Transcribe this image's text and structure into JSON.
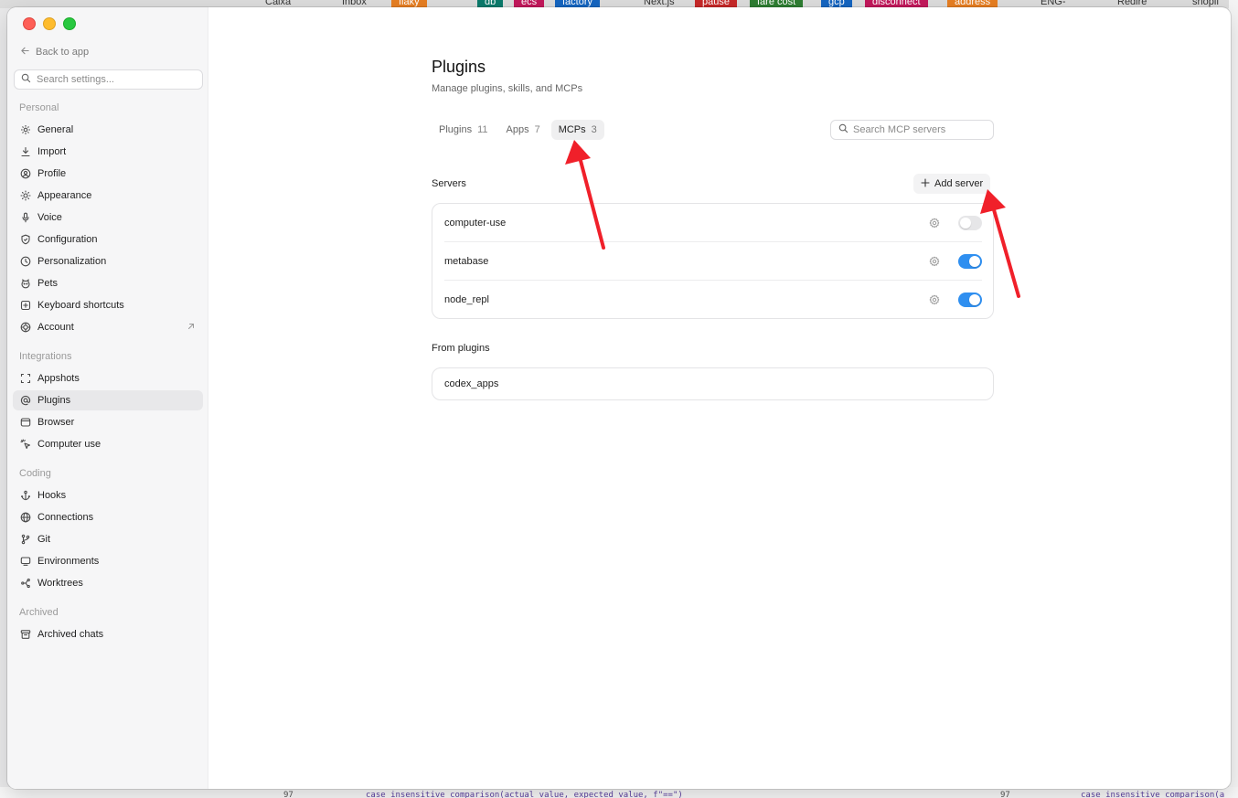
{
  "background": {
    "bookmarks": [
      {
        "label": "Caixa",
        "color": ""
      },
      {
        "label": "Inbox",
        "color": ""
      },
      {
        "label": "flaky",
        "color": "#e67e22"
      },
      {
        "label": "db",
        "color": "#0b7a6b"
      },
      {
        "label": "ecs",
        "color": "#c2185b"
      },
      {
        "label": "factory",
        "color": "#1565c0"
      },
      {
        "label": "Next.js",
        "color": ""
      },
      {
        "label": "pause",
        "color": "#c62828"
      },
      {
        "label": "fare cost",
        "color": "#2e7d32"
      },
      {
        "label": "gcp",
        "color": "#1565c0"
      },
      {
        "label": "disconnect",
        "color": "#c2185b"
      },
      {
        "label": "address",
        "color": "#e67e22"
      },
      {
        "label": "ENG-",
        "color": ""
      },
      {
        "label": "Redire",
        "color": ""
      },
      {
        "label": "shopif",
        "color": ""
      }
    ],
    "code_line_num_left": "97",
    "code_line_left": "case_insensitive_comparison(actual_value, expected_value, f\"==\")",
    "code_line_num_right": "97",
    "code_line_right": "case_insensitive_comparison(a"
  },
  "sidebar": {
    "back_label": "Back to app",
    "search_placeholder": "Search settings...",
    "sections": [
      {
        "label": "Personal",
        "items": [
          {
            "label": "General",
            "icon": "gear-icon"
          },
          {
            "label": "Import",
            "icon": "download-icon"
          },
          {
            "label": "Profile",
            "icon": "user-circle-icon"
          },
          {
            "label": "Appearance",
            "icon": "sun-icon"
          },
          {
            "label": "Voice",
            "icon": "microphone-icon"
          },
          {
            "label": "Configuration",
            "icon": "shield-icon"
          },
          {
            "label": "Personalization",
            "icon": "clock-icon"
          },
          {
            "label": "Pets",
            "icon": "pet-icon"
          },
          {
            "label": "Keyboard shortcuts",
            "icon": "keyboard-icon"
          },
          {
            "label": "Account",
            "icon": "account-icon",
            "external": true
          }
        ]
      },
      {
        "label": "Integrations",
        "items": [
          {
            "label": "Appshots",
            "icon": "capture-icon"
          },
          {
            "label": "Plugins",
            "icon": "at-icon",
            "active": true
          },
          {
            "label": "Browser",
            "icon": "browser-icon"
          },
          {
            "label": "Computer use",
            "icon": "cursor-icon"
          }
        ]
      },
      {
        "label": "Coding",
        "items": [
          {
            "label": "Hooks",
            "icon": "anchor-icon"
          },
          {
            "label": "Connections",
            "icon": "globe-icon"
          },
          {
            "label": "Git",
            "icon": "git-branch-icon"
          },
          {
            "label": "Environments",
            "icon": "monitor-icon"
          },
          {
            "label": "Worktrees",
            "icon": "worktree-icon"
          }
        ]
      },
      {
        "label": "Archived",
        "items": [
          {
            "label": "Archived chats",
            "icon": "archive-icon"
          }
        ]
      }
    ]
  },
  "main": {
    "title": "Plugins",
    "subtitle": "Manage plugins, skills, and MCPs",
    "tabs": [
      {
        "label": "Plugins",
        "count": "11"
      },
      {
        "label": "Apps",
        "count": "7"
      },
      {
        "label": "MCPs",
        "count": "3",
        "active": true
      }
    ],
    "search_placeholder": "Search MCP servers",
    "servers_heading": "Servers",
    "add_server_label": "Add server",
    "servers": [
      {
        "name": "computer-use",
        "enabled": false
      },
      {
        "name": "metabase",
        "enabled": true
      },
      {
        "name": "node_repl",
        "enabled": true
      }
    ],
    "from_plugins_heading": "From plugins",
    "plugin_servers": [
      {
        "name": "codex_apps"
      }
    ]
  },
  "colors": {
    "toggle_on": "#2f8ff0",
    "toggle_off": "#e6e6e8",
    "arrow": "#f0202a",
    "active_nav": "#e8e8ea"
  }
}
